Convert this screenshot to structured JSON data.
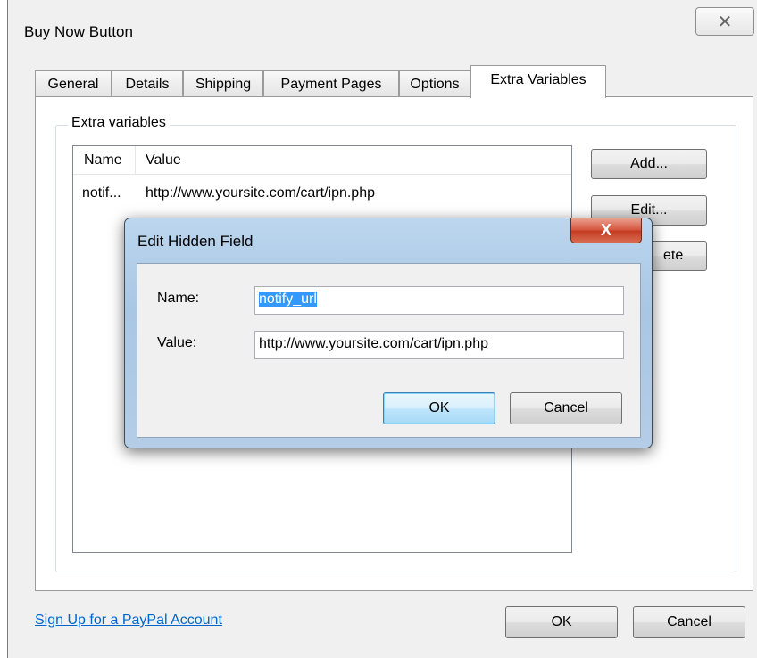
{
  "main": {
    "title": "Buy Now Button",
    "close_glyph": "✕",
    "tabs": [
      {
        "label": "General"
      },
      {
        "label": "Details"
      },
      {
        "label": "Shipping"
      },
      {
        "label": "Payment Pages"
      },
      {
        "label": "Options"
      },
      {
        "label": "Extra Variables"
      }
    ],
    "active_tab": "Extra Variables",
    "group_label": "Extra variables",
    "list": {
      "columns": [
        "Name",
        "Value"
      ],
      "rows": [
        {
          "name": "notif...",
          "value": "http://www.yoursite.com/cart/ipn.php"
        }
      ]
    },
    "side_buttons": {
      "add": "Add...",
      "edit": "Edit...",
      "delete_partial": "ete"
    },
    "signup_link": "Sign Up for a PayPal Account",
    "ok": "OK",
    "cancel": "Cancel"
  },
  "dialog": {
    "title": "Edit Hidden Field",
    "close_glyph": "X",
    "name_label": "Name:",
    "name_value": "notify_url",
    "value_label": "Value:",
    "value_value": "http://www.yoursite.com/cart/ipn.php",
    "ok": "OK",
    "cancel": "Cancel"
  }
}
